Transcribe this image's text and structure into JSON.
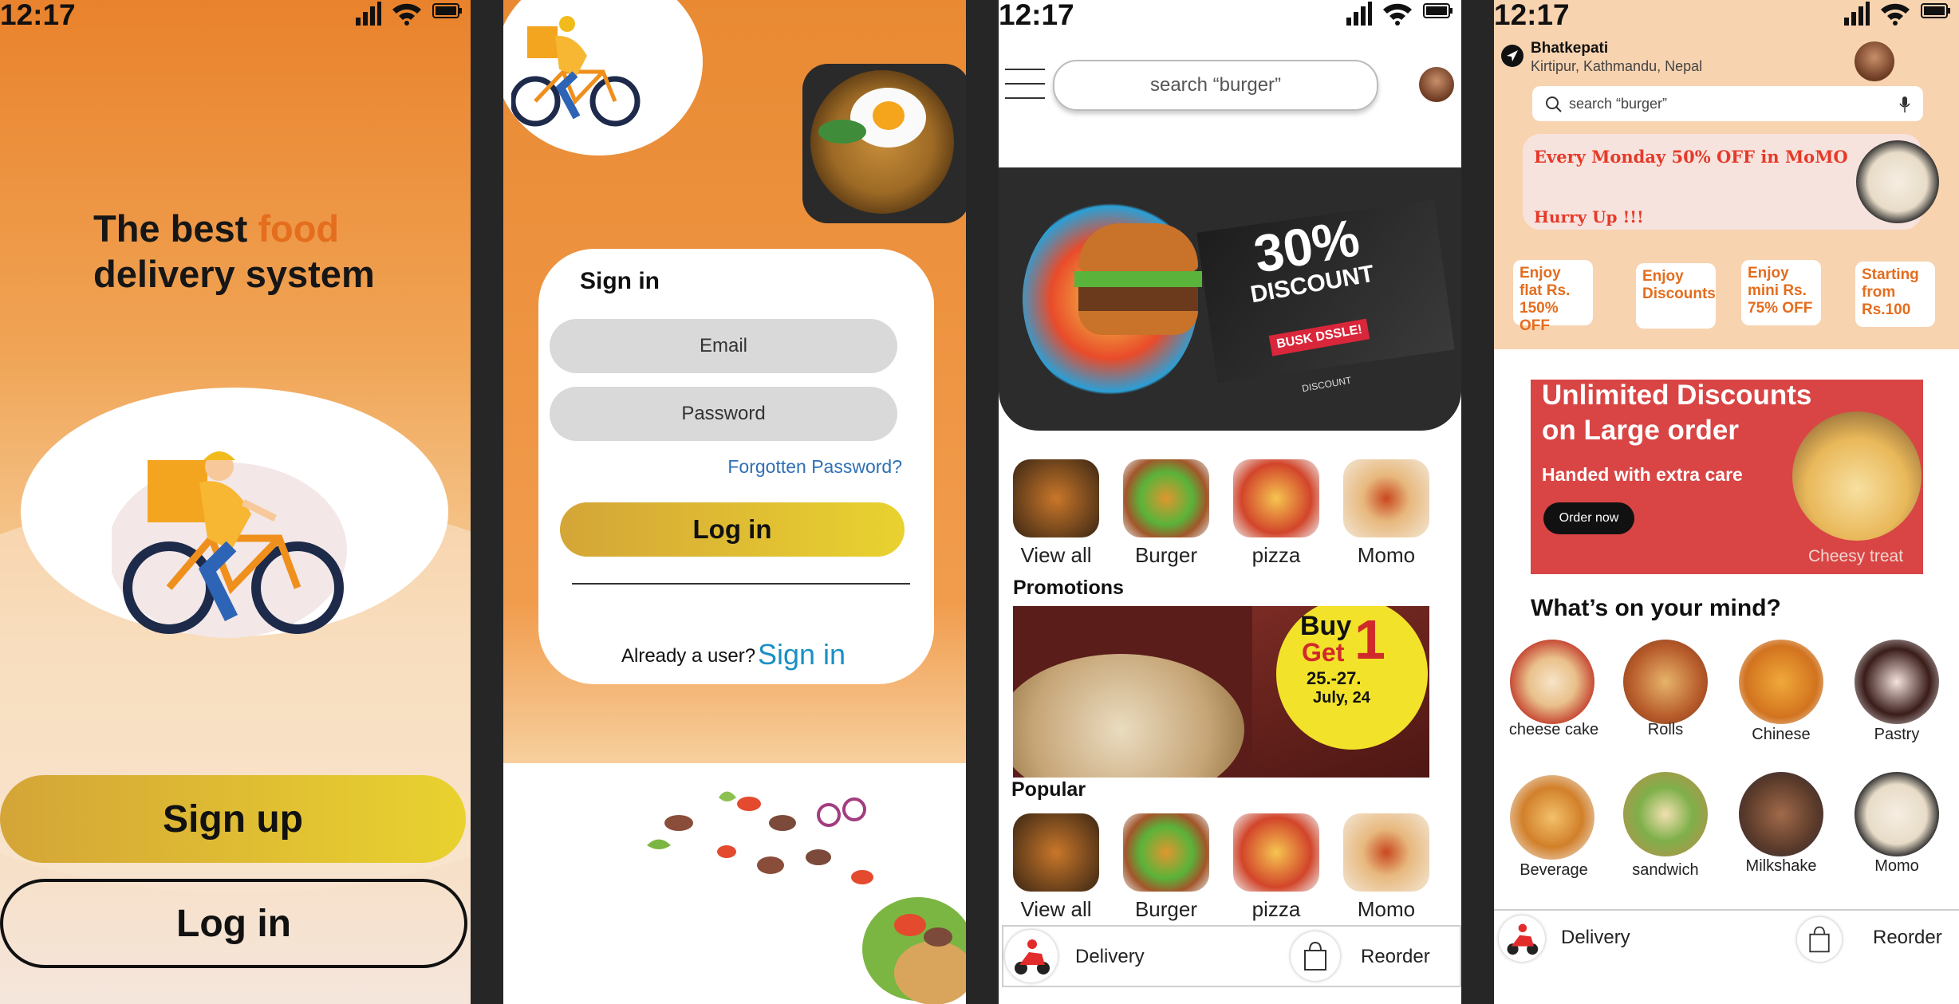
{
  "status_time": "12:17",
  "screen1": {
    "title_line1_prefix": "The best ",
    "title_accent": "food",
    "title_line2": "delivery system",
    "signup_label": "Sign up",
    "login_label": "Log in"
  },
  "screen2": {
    "heading": "Sign in",
    "email_placeholder": "Email",
    "password_placeholder": "Password",
    "forgot_label": "Forgotten Password?",
    "login_label": "Log in",
    "already_text": "Already a user?",
    "signin_link": "Sign in"
  },
  "screen3": {
    "search_placeholder": "search “burger”",
    "banner": {
      "headline": "30%",
      "subline": "DISCOUNT",
      "tag": "BUSK DSSLE!",
      "small": "DISCOUNT"
    },
    "categories": [
      "View all",
      "Burger",
      "pizza",
      "Momo"
    ],
    "promotions_title": "Promotions",
    "promo": {
      "buy": "Buy",
      "get": "Get",
      "num": "1",
      "dates": "25.-27.",
      "month": "July, 24"
    },
    "popular_title": "Popular",
    "popular": [
      "View all",
      "Burger",
      "pizza",
      "Momo"
    ],
    "nav": {
      "delivery": "Delivery",
      "reorder": "Reorder"
    }
  },
  "screen4": {
    "location_title": "Bhatkepati",
    "location_sub": "Kirtipur, Kathmandu, Nepal",
    "search_placeholder": "search “burger”",
    "promo_line1": "Every Monday 50% OFF in MoMO",
    "promo_line2": "Hurry Up !!!",
    "offers": [
      "Enjoy flat Rs. 150% OFF",
      "Enjoy Discounts",
      "Enjoy mini Rs. 75% OFF",
      "Starting from Rs.100"
    ],
    "big_banner": {
      "title1": "Unlimited Discounts",
      "title2": "on Large order",
      "sub": "Handed with extra care",
      "cta": "Order now",
      "caption": "Cheesy treat"
    },
    "mind_title": "What’s on your mind?",
    "mind_items": [
      "cheese cake",
      "Rolls",
      "Chinese",
      "Pastry",
      "Beverage",
      "sandwich",
      "Milkshake",
      "Momo"
    ],
    "nav": {
      "delivery": "Delivery",
      "reorder": "Reorder"
    }
  },
  "colors": {
    "accent_orange": "#e46d1e",
    "button_gold_start": "#d4a537",
    "button_gold_end": "#e9d22f",
    "link_blue": "#1a8fc4",
    "banner_red": "#d94545"
  }
}
